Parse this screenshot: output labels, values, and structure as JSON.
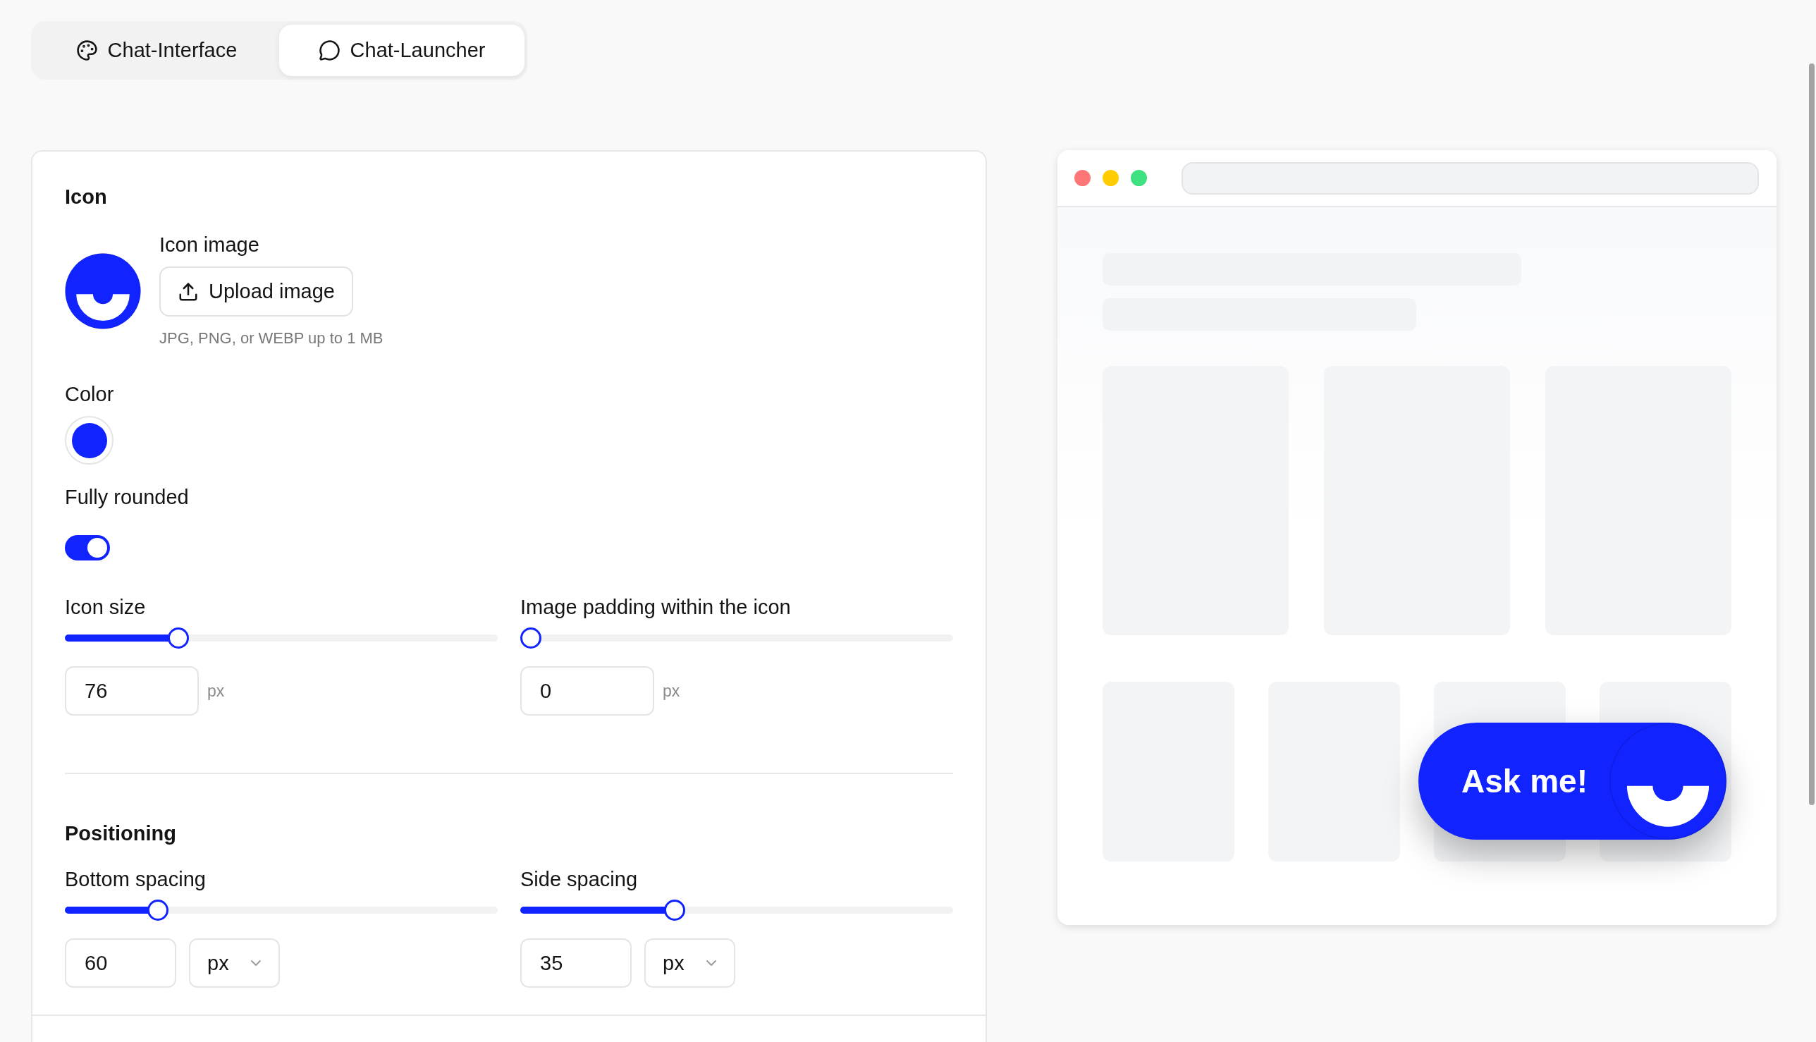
{
  "tabs": [
    {
      "label": "Chat-Interface",
      "selected": false
    },
    {
      "label": "Chat-Launcher",
      "selected": true
    }
  ],
  "icon_section": {
    "title": "Icon",
    "icon_image": {
      "label": "Icon image",
      "button": "Upload image",
      "hint": "JPG, PNG, or WEBP up to 1 MB"
    },
    "color": {
      "label": "Color",
      "color": "#1123ff"
    },
    "fully_rounded": {
      "label": "Fully rounded",
      "on": true
    },
    "sliders": [
      {
        "label": "Icon size",
        "kind": "fixed",
        "level": 0.25,
        "value": "76",
        "unit": "px"
      },
      {
        "label": "Image padding within the icon",
        "kind": "fixed",
        "level": 0,
        "value": "0",
        "unit": "px"
      }
    ]
  },
  "positioning": {
    "title": "Positioning",
    "sliders": [
      {
        "label": "Bottom spacing",
        "kind": "select",
        "level": 0.2,
        "value": "60",
        "unit": "px"
      },
      {
        "label": "Side spacing",
        "kind": "select",
        "level": 0.35,
        "value": "35",
        "unit": "px"
      }
    ]
  },
  "preview": {
    "launcher": {
      "label": "Ask me!"
    }
  }
}
